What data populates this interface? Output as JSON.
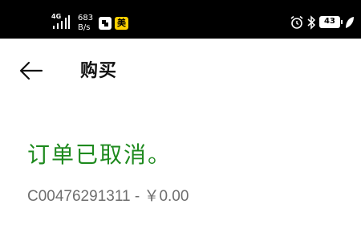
{
  "status_bar": {
    "network_type": "4G",
    "speed_value": "683",
    "speed_unit": "B/s",
    "app_badge_2": "美",
    "battery_level": "43",
    "colors": {
      "background": "#000000",
      "app_badge_2_bg": "#ffd100"
    },
    "icons": [
      "signal-icon",
      "app-notification-icon",
      "meituan-icon",
      "alarm-icon",
      "bluetooth-icon",
      "battery-icon",
      "leaf-icon"
    ]
  },
  "header": {
    "title": "购买",
    "back_icon": "arrow-left-icon"
  },
  "order": {
    "status_text": "订单已取消。",
    "order_id": "C00476291311",
    "separator": " - ",
    "amount": "￥0.00",
    "colors": {
      "status": "#1e8a1e",
      "detail": "#6e6e6e"
    }
  }
}
